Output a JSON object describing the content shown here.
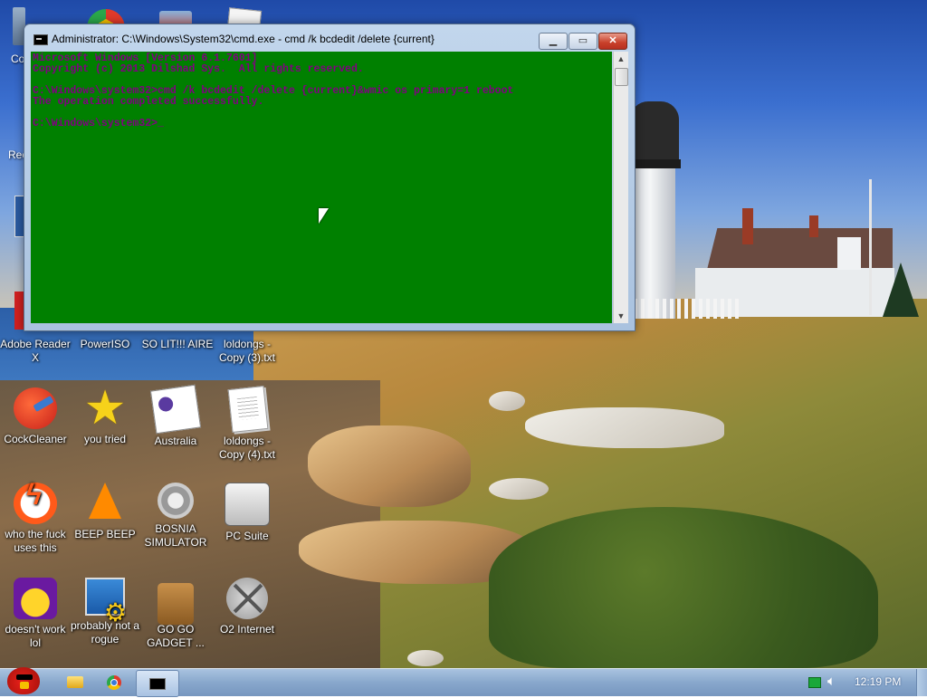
{
  "cmd_window": {
    "title": "Administrator: C:\\Windows\\System32\\cmd.exe - cmd  /k bcdedit /delete {current}",
    "minimize_label": "▁",
    "maximize_label": "▭",
    "close_label": "✕",
    "console_text": "Microsoft Windows [Version 6.1.7601]\nCopyright (c) 2013 Dilshad Sys.  All rights reserved.\n\nC:\\Windows\\system32>cmd /k bcdedit /delete {current}&wmic os primary=1 reboot\nThe operation completed successfully.\n\nC:\\Windows\\system32>_",
    "background_color": "#008000",
    "text_color": "#800080"
  },
  "desktop": {
    "partial_labels": [
      "Co",
      "Rec"
    ],
    "icons": [
      {
        "label": "Adobe Reader X",
        "icon": "adobe-reader-icon"
      },
      {
        "label": "PowerISO",
        "icon": "poweriso-icon"
      },
      {
        "label": "SO LIT!!! AIRE",
        "icon": "shortcut-icon"
      },
      {
        "label": "loldongs - Copy (3).txt",
        "icon": "text-file-icon"
      },
      {
        "label": "CockCleaner",
        "icon": "ccleaner-icon"
      },
      {
        "label": "you tried",
        "icon": "star-icon"
      },
      {
        "label": "Australia",
        "icon": "document-icon"
      },
      {
        "label": "loldongs - Copy (4).txt",
        "icon": "text-file-icon"
      },
      {
        "label": "who the fuck uses this",
        "icon": "flash-icon"
      },
      {
        "label": "BEEP BEEP",
        "icon": "vlc-cone-icon"
      },
      {
        "label": "BOSNIA SIMULATOR",
        "icon": "gear-icon"
      },
      {
        "label": "PC Suite",
        "icon": "phone-icon"
      },
      {
        "label": "doesn't work lol",
        "icon": "yahoo-messenger-icon"
      },
      {
        "label": "probably not a rogue",
        "icon": "settings-monitor-icon"
      },
      {
        "label": "GO GO GADGET ...",
        "icon": "briefcase-icon"
      },
      {
        "label": "O2 Internet",
        "icon": "o2-internet-icon"
      }
    ]
  },
  "taskbar": {
    "clock": "12:19 PM",
    "pinned": [
      {
        "name": "start-button",
        "icon": "angry-bird-icon"
      },
      {
        "name": "windows-explorer",
        "icon": "folder-icon"
      },
      {
        "name": "google-chrome",
        "icon": "chrome-icon"
      },
      {
        "name": "command-prompt",
        "icon": "cmd-icon",
        "active": true
      }
    ]
  }
}
